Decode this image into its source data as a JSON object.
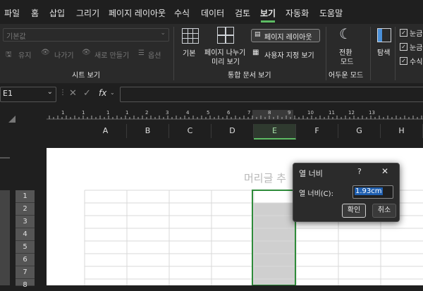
{
  "menu": {
    "items": [
      "파일",
      "홈",
      "삽입",
      "그리기",
      "페이지 레이아웃",
      "수식",
      "데이터",
      "검토",
      "보기",
      "자동화",
      "도움말"
    ],
    "active": "보기"
  },
  "ribbon": {
    "sheet_view": {
      "dropdown_value": "기본값",
      "keep": "유지",
      "exit": "나가기",
      "new": "새로 만들기",
      "options": "옵션",
      "group_label": "시트 보기"
    },
    "workbook_views": {
      "normal": "기본",
      "page_break_1": "페이지 나누기",
      "page_break_2": "미리 보기",
      "page_layout": "페이지 레이아웃",
      "custom_views": "사용자 지정 보기",
      "group_label": "통합 문서 보기"
    },
    "dark_mode": {
      "toggle_1": "전환",
      "toggle_2": "모드",
      "group_label": "어두운 모드"
    },
    "navigate": "탐색",
    "show": [
      "눈금",
      "눈금",
      "수식"
    ]
  },
  "formula_bar": {
    "name_box": "E1",
    "fx": "fx"
  },
  "ruler": {
    "labels": [
      "1",
      "1",
      "1",
      "1",
      "2",
      "3",
      "4",
      "5",
      "6",
      "7",
      "8",
      "9",
      "10",
      "11",
      "12",
      "13"
    ]
  },
  "columns": [
    "A",
    "B",
    "C",
    "D",
    "E",
    "F",
    "G",
    "H"
  ],
  "selected_column": "E",
  "rows": [
    "1",
    "2",
    "3",
    "4",
    "5",
    "6",
    "7",
    "8"
  ],
  "page": {
    "header_placeholder": "머리글 추"
  },
  "dialog": {
    "title": "열 너비",
    "help": "?",
    "close": "✕",
    "field_label": "열 너비(C):",
    "field_value": "1.93cm",
    "ok": "확인",
    "cancel": "취소"
  },
  "colors": {
    "accent": "#5dbb63",
    "selection": "#1f5fb0"
  }
}
